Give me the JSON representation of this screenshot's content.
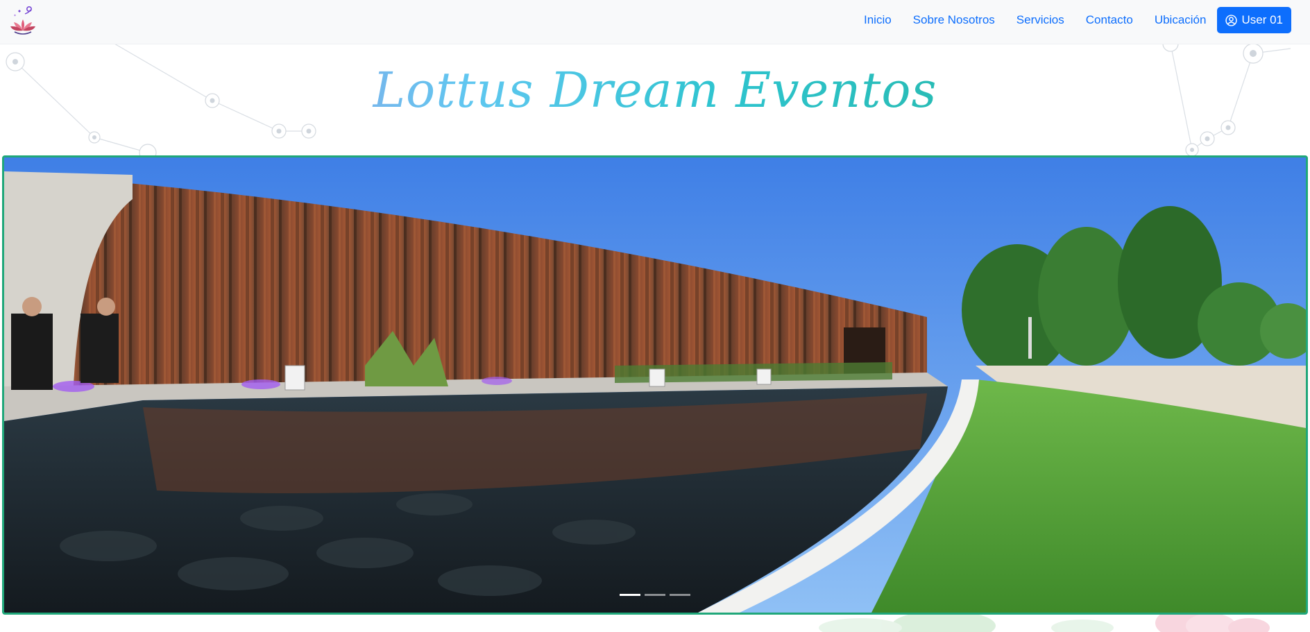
{
  "brand": {
    "logo_icon": "lotus-logo-icon",
    "title": "Lottus Dream Eventos",
    "title_gradient": [
      "#c77dde",
      "#5fc7f0",
      "#2ec4cf",
      "#1fae8a"
    ]
  },
  "nav": {
    "links": [
      {
        "label": "Inicio"
      },
      {
        "label": "Sobre Nosotros"
      },
      {
        "label": "Servicios"
      },
      {
        "label": "Contacto"
      },
      {
        "label": "Ubicación"
      }
    ],
    "user_button": {
      "label": "User 01",
      "icon": "user-circle-icon"
    }
  },
  "carousel": {
    "slide_count": 3,
    "active_index": 0,
    "border_color": "#20a77a"
  },
  "colors": {
    "link": "#0d6efd",
    "button_bg": "#0d6efd",
    "navbar_bg": "#f8f9fa"
  }
}
